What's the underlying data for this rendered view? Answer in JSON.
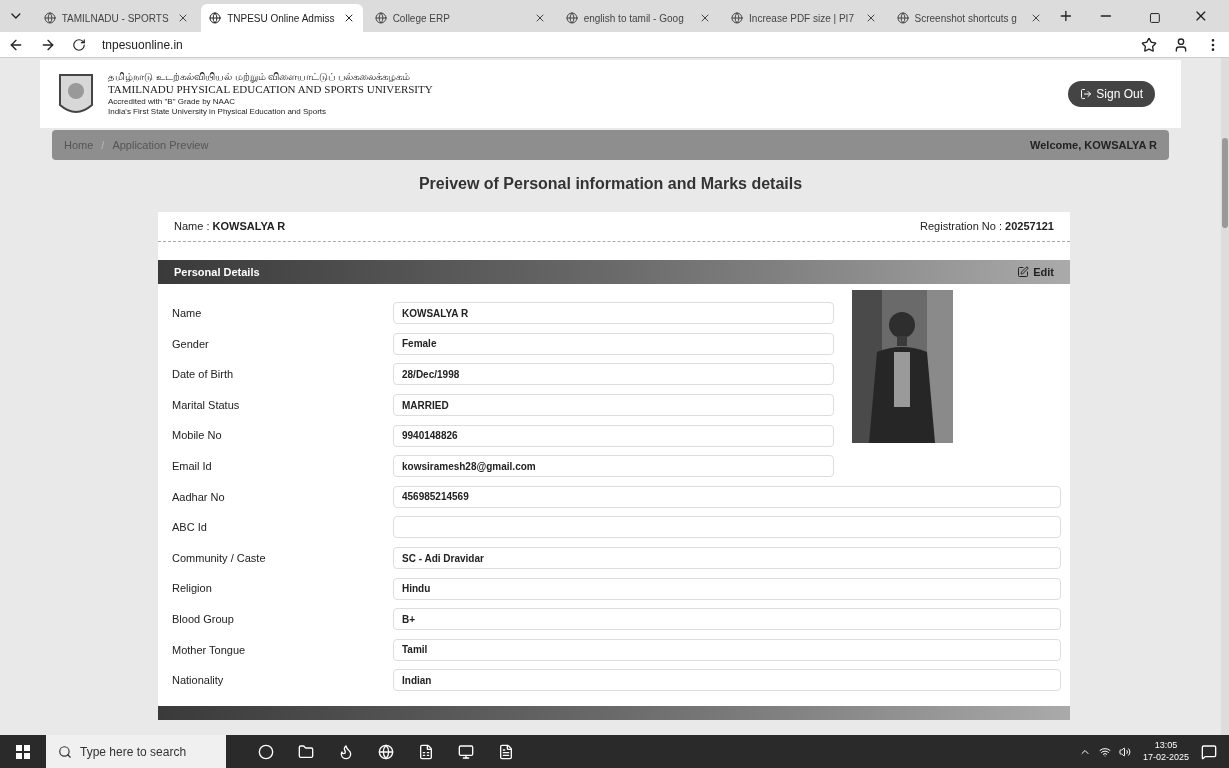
{
  "browser": {
    "tabs": [
      {
        "title": "TAMILNADU - SPORTS",
        "selected": false
      },
      {
        "title": "TNPESU Online Admiss",
        "selected": true
      },
      {
        "title": "College ERP",
        "selected": false
      },
      {
        "title": "english to tamil - Goog",
        "selected": false
      },
      {
        "title": "Increase PDF size | PI7",
        "selected": false
      },
      {
        "title": "Screenshot shortcuts g",
        "selected": false
      }
    ],
    "url": "tnpesuonline.in"
  },
  "header": {
    "tamil_name": "தமிழ்நாடு உடற்கல்வியியல் மற்றும் விளையாட்டுப் பல்கலைக்கழகம்",
    "name": "TAMILNADU PHYSICAL EDUCATION AND SPORTS UNIVERSITY",
    "accreditation": "Accredited with \"B\" Grade by NAAC",
    "tagline": "India's First State University in Physical Education and Sports",
    "sign_out": "Sign Out"
  },
  "breadcrumb": {
    "items": [
      "Home",
      "Application Preview"
    ],
    "separator": "/",
    "welcome": "Welcome, KOWSALYA R"
  },
  "page_title": "Preivew of Personal information and Marks details",
  "summary": {
    "name_label": "Name : ",
    "name": "KOWSALYA R",
    "reg_label": "Registration No : ",
    "reg_no": "20257121"
  },
  "section": {
    "title": "Personal Details",
    "edit": "Edit"
  },
  "fields": [
    {
      "label": "Name",
      "value": "KOWSALYA R"
    },
    {
      "label": "Gender",
      "value": "Female"
    },
    {
      "label": "Date of Birth",
      "value": "28/Dec/1998"
    },
    {
      "label": "Marital Status",
      "value": "MARRIED"
    },
    {
      "label": "Mobile No",
      "value": "9940148826"
    },
    {
      "label": "Email Id",
      "value": "kowsiramesh28@gmail.com"
    },
    {
      "label": "Aadhar No",
      "value": "456985214569"
    },
    {
      "label": "ABC Id"
    },
    {
      "label": "Community / Caste",
      "value": "SC - Adi Dravidar"
    },
    {
      "label": "Religion",
      "value": "Hindu"
    },
    {
      "label": "Blood Group",
      "value": "B+"
    },
    {
      "label": "Mother Tongue",
      "value": "Tamil"
    },
    {
      "label": "Nationality",
      "value": "Indian"
    }
  ],
  "taskbar": {
    "search_placeholder": "Type here to search",
    "time": "13:05",
    "date": "17-02-2025"
  }
}
